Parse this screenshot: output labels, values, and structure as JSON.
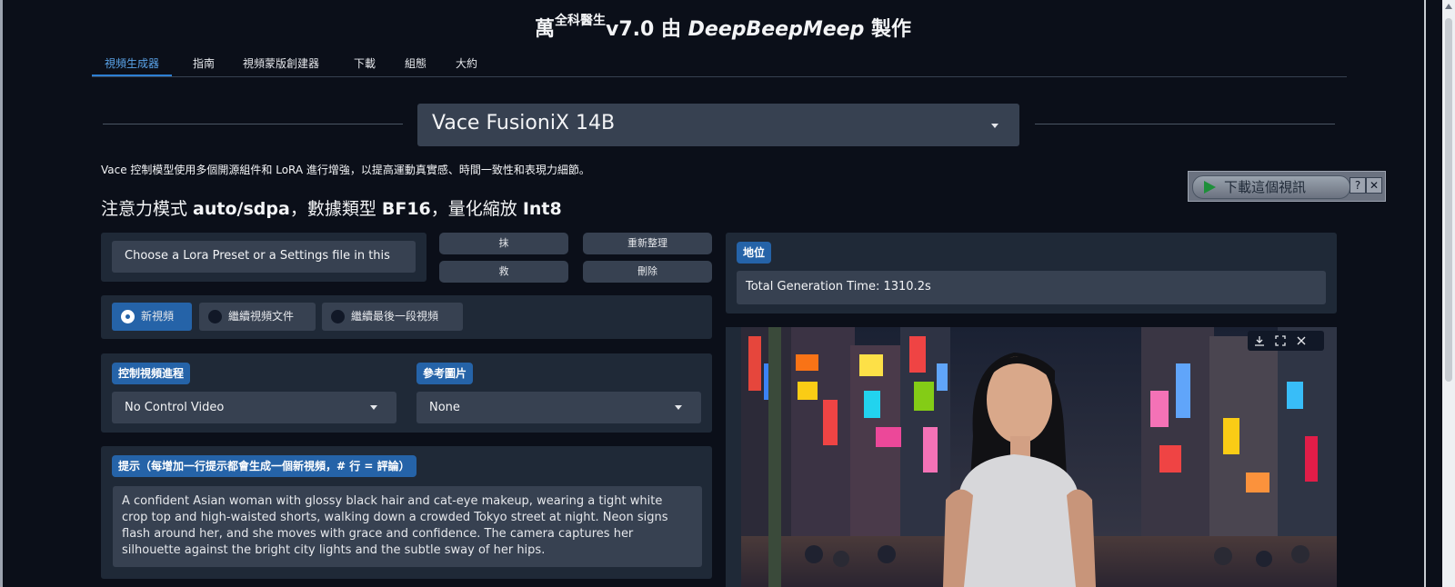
{
  "title": {
    "main": "萬",
    "sup": "全科醫生",
    "version": "v7.0 由 ",
    "brand": "DeepBeepMeep",
    "suffix": " 製作"
  },
  "tabs": [
    "視頻生成器",
    "指南",
    "視頻蒙版創建器",
    "下載",
    "組態",
    "大約"
  ],
  "model": {
    "selected": "Vace FusioniX 14B"
  },
  "description": "Vace 控制模型使用多個開源組件和 LoRA 進行增強，以提高運動真實感、時間一致性和表現力細節。",
  "attention": {
    "prefix": "注意力模式 ",
    "mode": "auto/sdpa",
    "mid": "，數據類型 ",
    "dtype": "BF16",
    "mid2": "，量化縮放 ",
    "quant": "Int8"
  },
  "lora_preset": {
    "placeholder": "Choose a Lora Preset or a Settings file in this"
  },
  "buttons": {
    "erase": "抹",
    "save": "救",
    "refresh": "重新整理",
    "delete": "刪除"
  },
  "video_mode": {
    "options": [
      "新視頻",
      "繼續視頻文件",
      "繼續最後一段視頻"
    ],
    "selected_index": 0
  },
  "control_video": {
    "label": "控制視頻進程",
    "value": "No Control Video"
  },
  "reference_image": {
    "label": "參考圖片",
    "value": "None"
  },
  "prompt": {
    "label": "提示（每增加一行提示都會生成一個新視頻，# 行 = 評論）",
    "lines": [
      "A confident Asian woman with glossy black hair and cat-eye makeup, wearing a tight white",
      "crop top and high-waisted shorts, walking down a crowded Tokyo street at night. Neon signs",
      "flash around her, and she moves with grace and confidence. The camera captures her",
      "silhouette against the bright city lights and the subtle sway of her hips."
    ]
  },
  "status": {
    "label": "地位",
    "text": "Total Generation Time: 1310.2s"
  },
  "download_overlay": {
    "label": "下載這個視訊",
    "help": "?",
    "close": "✕"
  },
  "video_controls": {
    "download_icon": "download-icon",
    "fullscreen_icon": "fullscreen-icon",
    "close_icon": "close-icon"
  },
  "colors": {
    "bg": "#0b0f19",
    "panel": "#1f2937",
    "input": "#374151",
    "accent": "#2563a8",
    "tab_active": "#5aa3e8"
  }
}
